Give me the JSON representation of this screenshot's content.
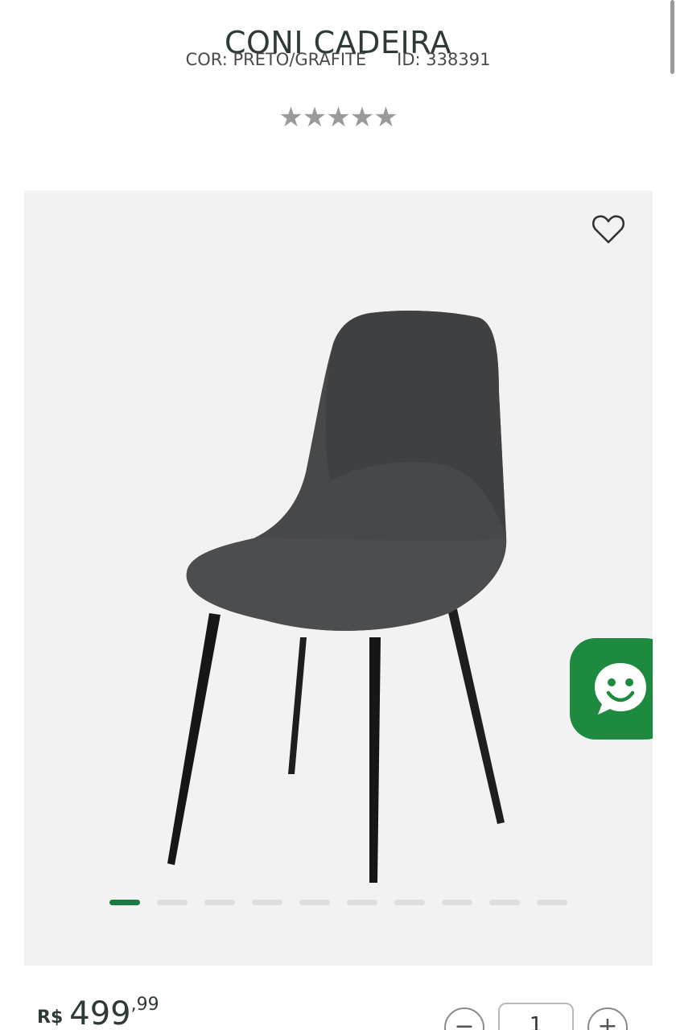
{
  "product": {
    "title": "CONI CADEIRA",
    "color_text": "COR: PRETO/GRAFITE",
    "id_text": "ID: 338391",
    "rating_stars": "★★★★★",
    "rating_value": 0
  },
  "gallery": {
    "image_count": 10,
    "active_index": 0,
    "favorite_icon": "heart-outline-icon",
    "chat_icon": "smiley-chat-icon",
    "chat_color": "#1d8a3f",
    "active_dot_color": "#1a7a43"
  },
  "price": {
    "currency": "R$",
    "integer": "499",
    "decimal": ",99"
  },
  "quantity": {
    "value": "1",
    "minus_label": "−",
    "plus_label": "+"
  }
}
